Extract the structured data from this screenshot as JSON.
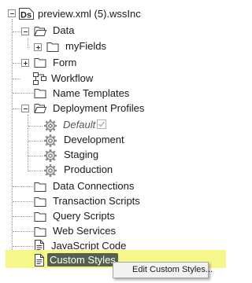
{
  "tree": {
    "root": {
      "label": "preview.xml (5).wssInc",
      "icon": "data-source-icon"
    },
    "data": {
      "label": "Data",
      "icon": "folder-open-icon"
    },
    "my_fields": {
      "label": "myFields",
      "icon": "folder-icon"
    },
    "form": {
      "label": "Form",
      "icon": "folder-icon"
    },
    "workflow": {
      "label": "Workflow",
      "icon": "workflow-icon"
    },
    "name_templates": {
      "label": "Name Templates",
      "icon": "folder-icon"
    },
    "deployment_profiles": {
      "label": "Deployment Profiles",
      "icon": "folder-open-icon"
    },
    "default": {
      "label": "Default",
      "icon": "gear-icon",
      "checked": true
    },
    "development": {
      "label": "Development",
      "icon": "gear-icon"
    },
    "staging": {
      "label": "Staging",
      "icon": "gear-icon"
    },
    "production": {
      "label": "Production",
      "icon": "gear-icon"
    },
    "data_connections": {
      "label": "Data Connections",
      "icon": "folder-icon"
    },
    "transaction_scripts": {
      "label": "Transaction Scripts",
      "icon": "folder-icon"
    },
    "query_scripts": {
      "label": "Query Scripts",
      "icon": "folder-icon"
    },
    "web_services": {
      "label": "Web Services",
      "icon": "folder-icon"
    },
    "javascript_code": {
      "label": "JavaScript Code",
      "icon": "file-icon"
    },
    "custom_styles": {
      "label": "Custom Styles",
      "icon": "file-icon"
    }
  },
  "context_menu": {
    "items": [
      {
        "label": "Edit Custom Styles..."
      }
    ]
  },
  "colors": {
    "highlight": "#f6f78a",
    "selection": "#55614c",
    "gear": "#8a8a8a"
  }
}
